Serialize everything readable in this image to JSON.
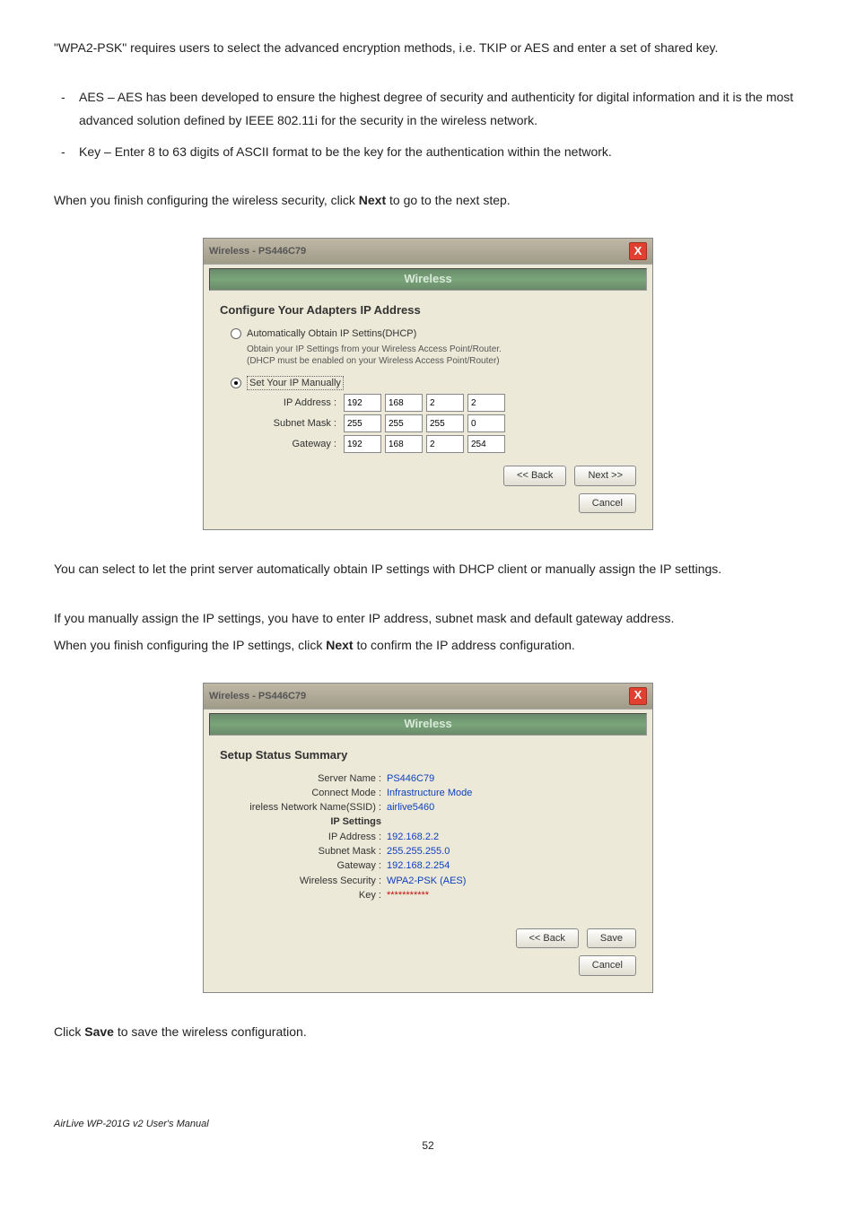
{
  "para1": "\"WPA2-PSK\" requires users to select the advanced encryption methods, i.e. TKIP or AES and enter a set of shared key.",
  "bullet1": "AES – AES has been developed to ensure the highest degree of security and authenticity for digital information and it is the most advanced solution defined by IEEE 802.11i for the security in the wireless network.",
  "bullet2": "Key – Enter 8 to 63 digits of ASCII format to be the key for the authentication within the network.",
  "para2a": "When you finish configuring the wireless security, click ",
  "para2b": "Next",
  "para2c": " to go to the next step.",
  "dialog1": {
    "title": "Wireless - PS446C79",
    "close": "X",
    "banner": "Wireless",
    "section": "Configure Your Adapters IP Address",
    "radio1": "Automatically Obtain IP Settins(DHCP)",
    "hint1": "Obtain your IP Settings from your Wireless Access Point/Router.",
    "hint2": "(DHCP must be enabled on your Wireless Access Point/Router)",
    "radio2": "Set Your IP Manually",
    "ip_label": "IP Address :",
    "ip": [
      "192",
      "168",
      "2",
      "2"
    ],
    "mask_label": "Subnet Mask :",
    "mask": [
      "255",
      "255",
      "255",
      "0"
    ],
    "gw_label": "Gateway :",
    "gw": [
      "192",
      "168",
      "2",
      "254"
    ],
    "back": "<< Back",
    "next": "Next >>",
    "cancel": "Cancel"
  },
  "para3": "You can select to let the print server automatically obtain IP settings with DHCP client or manually assign the IP settings.",
  "para4": "If you manually assign the IP settings, you have to enter IP address, subnet mask and default gateway address.",
  "para5a": "When you finish configuring the IP settings, click ",
  "para5b": "Next",
  "para5c": " to confirm the IP address configuration.",
  "dialog2": {
    "title": "Wireless - PS446C79",
    "close": "X",
    "banner": "Wireless",
    "section": "Setup Status Summary",
    "rows": [
      {
        "label": "Server Name :",
        "value": "PS446C79"
      },
      {
        "label": "Connect Mode :",
        "value": "Infrastructure Mode"
      },
      {
        "label": "ireless Network Name(SSID) :",
        "value": "airlive5460"
      }
    ],
    "ipsettings": "IP Settings",
    "rows2": [
      {
        "label": "IP Address :",
        "value": "192.168.2.2"
      },
      {
        "label": "Subnet Mask :",
        "value": "255.255.255.0"
      },
      {
        "label": "Gateway :",
        "value": "192.168.2.254"
      },
      {
        "label": "Wireless Security :",
        "value": "WPA2-PSK (AES)"
      },
      {
        "label": "Key :",
        "value": "***********"
      }
    ],
    "back": "<< Back",
    "save": "Save",
    "cancel": "Cancel"
  },
  "para6a": "Click ",
  "para6b": "Save",
  "para6c": " to save the wireless configuration.",
  "footer": "AirLive WP-201G v2 User's Manual",
  "pagenum": "52"
}
